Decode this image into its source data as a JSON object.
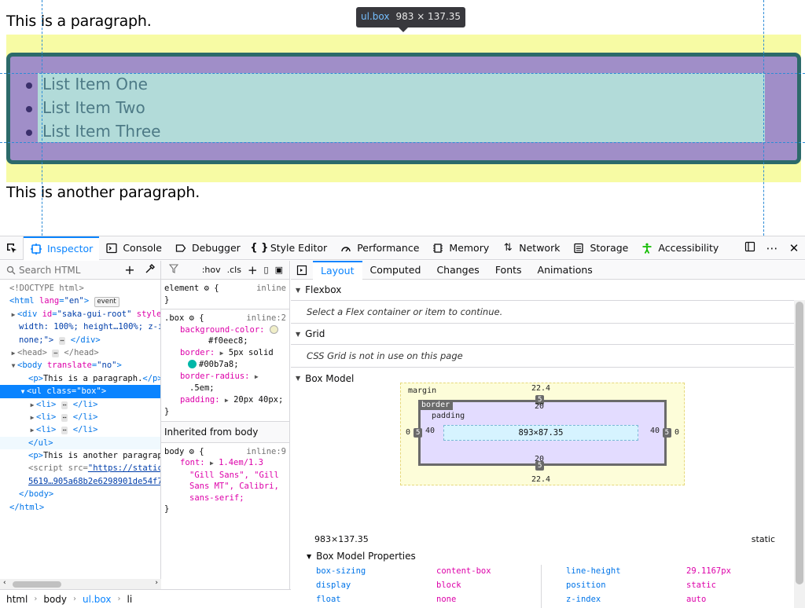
{
  "preview": {
    "paragraph1": "This is a paragraph.",
    "paragraph2": "This is another paragraph.",
    "list_items": [
      "List Item One",
      "List Item Two",
      "List Item Three"
    ],
    "tooltip_tag": "ul",
    "tooltip_class": ".box",
    "tooltip_dims": "983 × 137.35",
    "colors": {
      "margin": "#f7fba4",
      "border": "#2c6a6a",
      "padding": "#a08ec8",
      "content": "#b2dbd9"
    }
  },
  "toolbar": {
    "tabs": [
      "Inspector",
      "Console",
      "Debugger",
      "Style Editor",
      "Performance",
      "Memory",
      "Network",
      "Storage",
      "Accessibility"
    ],
    "tab_icons": [
      "inspector-icon",
      "console-icon",
      "debugger-icon",
      "style-editor-icon",
      "performance-icon",
      "memory-icon",
      "network-icon",
      "storage-icon",
      "accessibility-icon"
    ],
    "selected": "Inspector"
  },
  "markup": {
    "search_placeholder": "Search HTML",
    "lines": [
      "<!DOCTYPE html>",
      "<html lang=\"en\">",
      "<div id=\"saka-gui-root\" style=",
      "width: 100%; height…100%; z-i",
      "none;\">",
      "<head>",
      "<body translate=\"no\">",
      "<p>This is a paragraph.</p>",
      "<ul class=\"box\">",
      "<li>",
      "<li>",
      "<li>",
      "</ul>",
      "<p>This is another paragraph",
      "<script src=\"https://static",
      "5619…905a68b2e6298901de54f7",
      "</body>",
      "</html>"
    ],
    "event_badge": "event"
  },
  "breadcrumbs": [
    "html",
    "body",
    "ul.box",
    "li"
  ],
  "rules": {
    "toolbar": {
      "hov": ":hov",
      "cls": ".cls"
    },
    "element_rule": {
      "selector": "element",
      "source": "inline"
    },
    "box_rule": {
      "selector": ".box",
      "source": "inline:2",
      "bg_prop": "background-color:",
      "bg_val": "#f0eec8;",
      "border_prop": "border:",
      "border_val1": "5px solid",
      "border_val2": "#00b7a8;",
      "radius_prop": "border-radius:",
      "radius_val": ".5em;",
      "padding_prop": "padding:",
      "padding_val": "20px 40px;"
    },
    "inherited_header": "Inherited from body",
    "body_rule": {
      "selector": "body",
      "source": "inline:9",
      "font_prop": "font:",
      "font_val1": "1.4em/1.3",
      "font_val2": "\"Gill Sans\", \"Gill",
      "font_val3": "Sans MT\", Calibri,",
      "font_val4": "sans-serif;"
    }
  },
  "layout": {
    "tabs": [
      "Layout",
      "Computed",
      "Changes",
      "Fonts",
      "Animations"
    ],
    "flexbox_title": "Flexbox",
    "flexbox_msg": "Select a Flex container or item to continue.",
    "grid_title": "Grid",
    "grid_msg": "CSS Grid is not in use on this page",
    "boxmodel_title": "Box Model",
    "box_model": {
      "margin_label": "margin",
      "border_label": "border",
      "padding_label": "padding",
      "margin_top": "22.4",
      "margin_bottom": "22.4",
      "margin_left": "0",
      "margin_right": "0",
      "border_top": "5",
      "border_bottom": "5",
      "border_left": "5",
      "border_right": "5",
      "padding_top": "20",
      "padding_bottom": "20",
      "padding_left": "40",
      "padding_right": "40",
      "content": "893×87.35"
    },
    "dims": "983×137.35",
    "position": "static",
    "props_title": "Box Model Properties",
    "props": [
      [
        "box-sizing",
        "content-box",
        "line-height",
        "29.1167px"
      ],
      [
        "display",
        "block",
        "position",
        "static"
      ],
      [
        "float",
        "none",
        "z-index",
        "auto"
      ]
    ]
  }
}
